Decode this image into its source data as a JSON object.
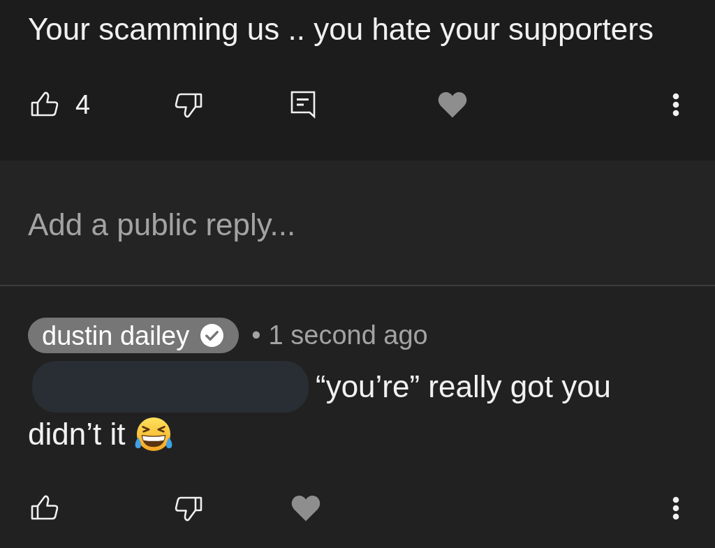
{
  "comment": {
    "text": "Your scamming us .. you hate your supporters",
    "actions": [
      {
        "kind": "like",
        "count": "4"
      },
      {
        "kind": "dislike"
      },
      {
        "kind": "reply"
      },
      {
        "kind": "heart"
      },
      {
        "kind": "more"
      }
    ]
  },
  "reply_box": {
    "placeholder": "Add a public reply..."
  },
  "reply": {
    "author": "dustin dailey",
    "verified": true,
    "separator": "•",
    "time": "1 second ago",
    "lines": [
      [
        {
          "kind": "redaction"
        },
        {
          "kind": "text",
          "text": "“you’re” really got you"
        }
      ],
      [
        {
          "kind": "text",
          "text": "didn’t it"
        },
        {
          "kind": "emoji"
        }
      ]
    ],
    "actions": [
      {
        "kind": "like"
      },
      {
        "kind": "dislike"
      },
      {
        "kind": "heart"
      },
      {
        "kind": "more"
      }
    ]
  }
}
